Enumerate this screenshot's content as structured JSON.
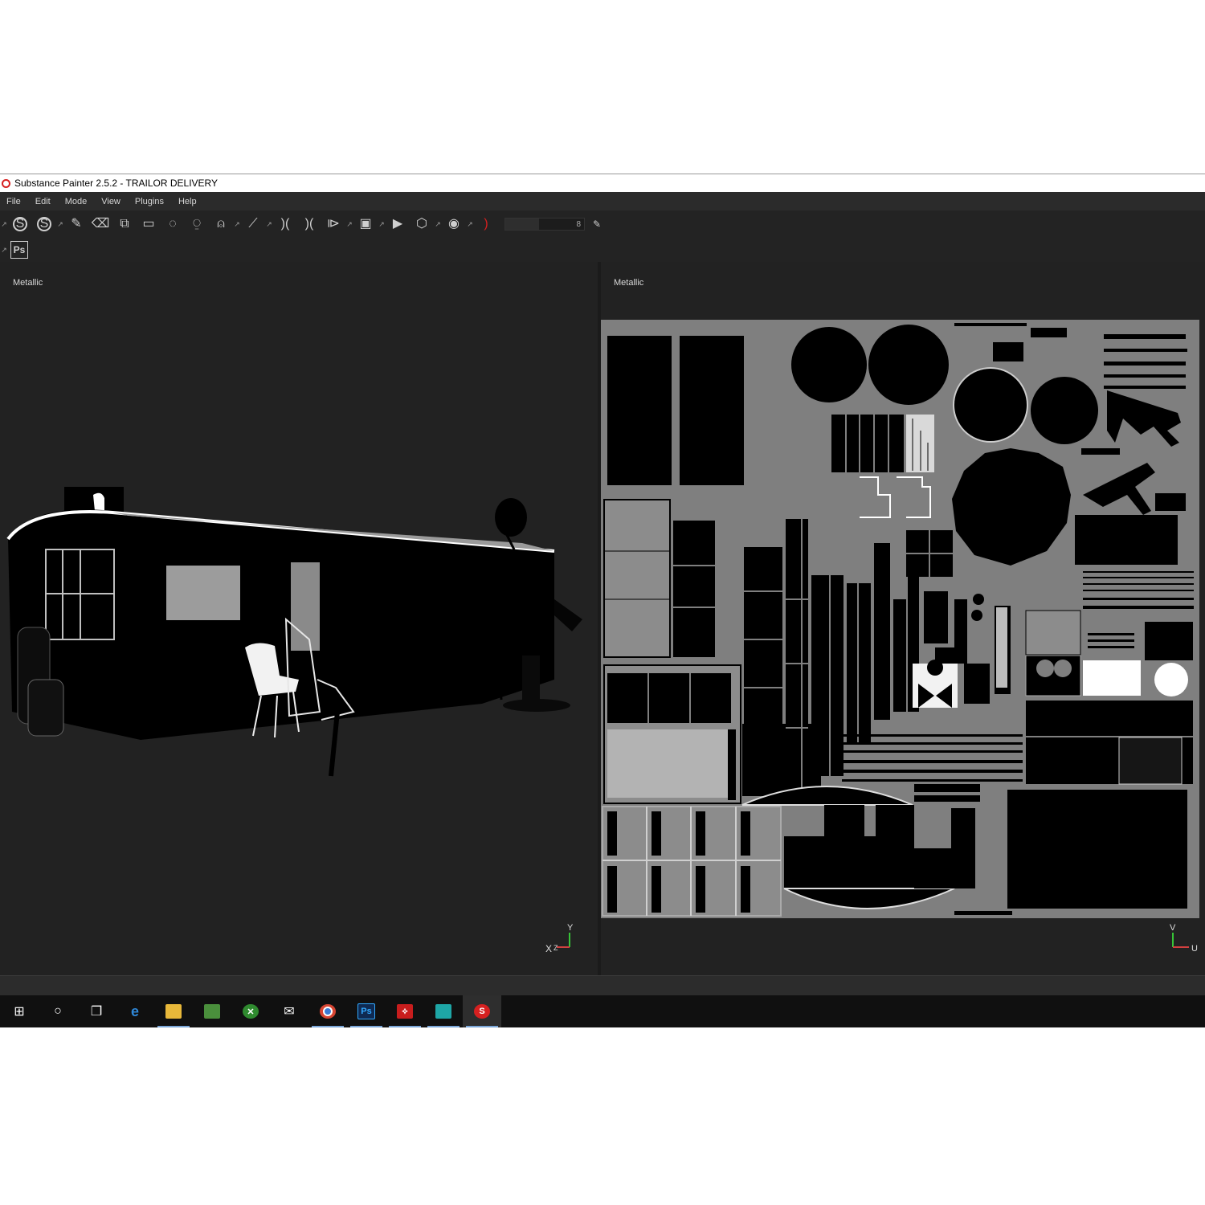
{
  "window": {
    "title": "Substance Painter 2.5.2 - TRAILOR DELIVERY"
  },
  "menu": {
    "items": [
      "File",
      "Edit",
      "Mode",
      "View",
      "Plugins",
      "Help"
    ]
  },
  "toolbar": {
    "brush_size": "8",
    "tools": [
      "substance-logo-icon",
      "substance-icon",
      "paint-brush-icon",
      "eraser-icon",
      "projection-icon",
      "polygon-fill-icon",
      "smudge-icon",
      "clone-icon",
      "material-picker-icon",
      "color-picker-icon",
      "symmetry-icon",
      "symmetry-toggle-icon",
      "mirror-icon",
      "viewport-mode-icon",
      "camera-icon",
      "cube-icon",
      "screenshot-icon",
      "red-bracket-icon"
    ],
    "photoshop_label": "Ps"
  },
  "viewport_3d": {
    "channel": "Metallic",
    "axis_x": "X",
    "axis_y": "Y",
    "axis_z": "Z"
  },
  "viewport_2d": {
    "channel": "Metallic",
    "axis_v": "V",
    "axis_u": "U"
  },
  "taskbar": {
    "items": [
      {
        "icon": "windows-start-icon",
        "active": false
      },
      {
        "icon": "cortana-icon",
        "active": false
      },
      {
        "icon": "task-view-icon",
        "active": false
      },
      {
        "icon": "edge-icon",
        "active": false
      },
      {
        "icon": "file-explorer-icon",
        "active": true
      },
      {
        "icon": "green-app-icon",
        "active": false
      },
      {
        "icon": "xbox-icon",
        "active": false
      },
      {
        "icon": "mail-icon",
        "active": false
      },
      {
        "icon": "chrome-icon",
        "active": true
      },
      {
        "icon": "photoshop-icon",
        "active": true
      },
      {
        "icon": "acrobat-icon",
        "active": true
      },
      {
        "icon": "maya-icon",
        "active": true
      },
      {
        "icon": "substance-painter-icon",
        "active": true
      }
    ]
  },
  "colors": {
    "app_bg": "#1b1b1b",
    "viewport_bg": "#222222",
    "uv_bg": "#7f7f7f",
    "metal_white": "#ffffff",
    "non_metal": "#000000",
    "accent_red": "#d62020"
  }
}
